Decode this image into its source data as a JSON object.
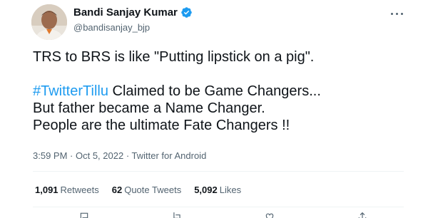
{
  "author": {
    "display_name": "Bandi Sanjay Kumar",
    "handle": "@bandisanjay_bjp",
    "verified": true,
    "verified_color": "#1d9bf0"
  },
  "tweet": {
    "line1": "TRS to BRS is like \"Putting lipstick on a pig\".",
    "hashtag": "#TwitterTillu",
    "line2_rest": " Claimed to be Game Changers...",
    "line3": "But father became a Name Changer.",
    "line4": "People are the ultimate Fate Changers !!"
  },
  "meta": {
    "time": "3:59 PM",
    "sep": " · ",
    "date": "Oct 5, 2022",
    "source": "Twitter for Android"
  },
  "stats": {
    "retweets_count": "1,091",
    "retweets_label": "Retweets",
    "quotes_count": "62",
    "quotes_label": "Quote Tweets",
    "likes_count": "5,092",
    "likes_label": "Likes"
  },
  "colors": {
    "link": "#1d9bf0",
    "secondary_text": "#536471",
    "primary_text": "#0f1419",
    "divider": "#eff3f4"
  },
  "icons": [
    "verified-badge-icon",
    "more-options-icon",
    "reply-icon",
    "retweet-icon",
    "like-icon",
    "share-icon"
  ]
}
